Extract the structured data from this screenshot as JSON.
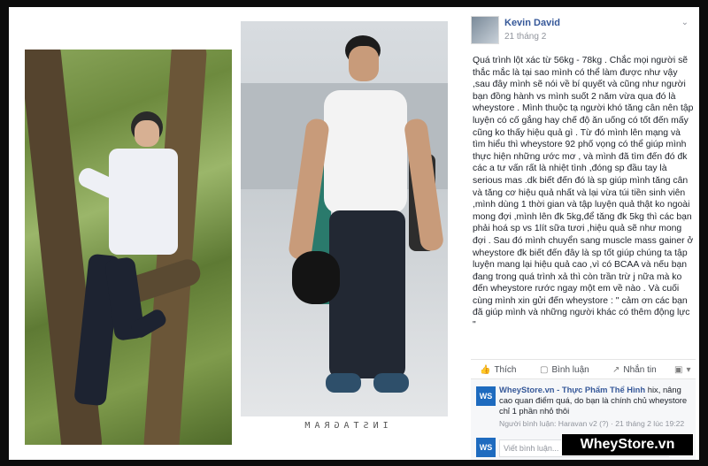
{
  "post": {
    "author": "Kevin David",
    "date": "21 tháng 2",
    "text": "Quá trình lột xác từ 56kg - 78kg . Chắc mọi người sẽ thắc mắc là tại sao mình có thể làm được như vậy ,sau đây mình sẽ nói về bí quyết và cũng như người bạn đồng hành vs mình suốt 2 năm vừa qua đó là wheystore . Mình thuộc tạ người khó tăng cân nên tập luyện có cố gắng hay chế độ ăn uống có tốt đến mấy cũng ko thấy hiệu quả gì . Từ đó mình lên mạng và tìm hiểu thì wheystore 92 phố vọng có thể giúp mình thực hiện những ước mơ , và mình đã tìm đến đó đk các a tư vấn rất là nhiệt tình ,đóng sp đầu tay là serious mas .dk biết đến đó là sp giúp mình tăng cân và tăng cơ hiệu quả nhất và lại vừa túi tiền sinh viên ,mình dùng 1 thời gian và tập luyện quả thật ko ngoài mong đợi ,mình lên đk 5kg,để tăng đk 5kg thì các bạn phải hoá sp vs 1lít sữa tươi ,hiệu quả sẽ như mong đợi . Sau đó mình chuyển sang muscle mass gainer ở wheystore đk biết đến đây là sp tốt giúp chúng ta tập luyện mang lại hiệu quả cao ,vì có BCAA và nếu bạn đang trong quá trình xả thì còn trần trừ j nữa mà ko đến wheystore rước ngay một em về nào . Và cuối cùng mình xin gửi đến wheystore : \" cảm ơn các bạn đã giúp mình và những người khác có thêm động lực \""
  },
  "actions": {
    "like": "Thích",
    "comment": "Bình luận",
    "share": "Nhắn tin"
  },
  "comment": {
    "name": "WheyStore.vn - Thực Phẩm Thể Hình",
    "text": "hix, nâng cao quan điểm quá, do bạn là chính chủ wheystore chỉ 1 phần nhỏ thôi",
    "meta": "Người bình luận: Haravan v2 (?) · 21 tháng 2 lúc 19:22",
    "avatar_text": "WS"
  },
  "reply_placeholder": "Viết bình luận...",
  "photo_caption": "INSTAGRAM",
  "watermark": "WheyStore.vn"
}
